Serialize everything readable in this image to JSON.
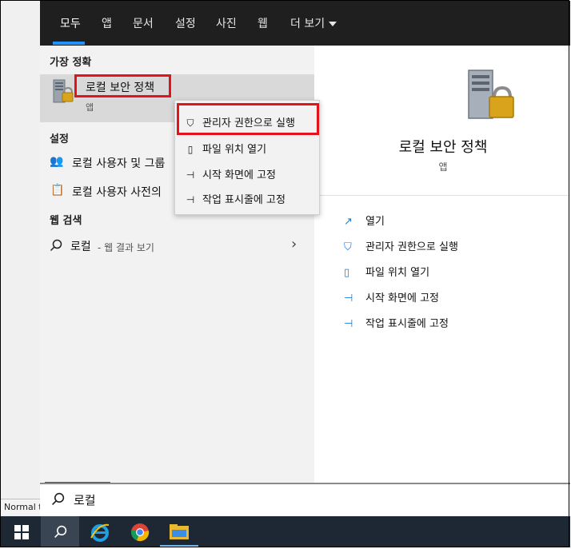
{
  "background": {
    "normal_label": "Normal t"
  },
  "tabs": [
    {
      "label": "모두",
      "active": true
    },
    {
      "label": "앱"
    },
    {
      "label": "문서"
    },
    {
      "label": "설정"
    },
    {
      "label": "사진"
    },
    {
      "label": "웹"
    },
    {
      "label": "더 보기"
    }
  ],
  "left": {
    "best_match_header": "가장 정확",
    "best_match": {
      "title": "로컬 보안 정책",
      "subtitle": "앱"
    },
    "settings_header": "설정",
    "settings_items": [
      {
        "label": "로컬 사용자 및 그룹"
      },
      {
        "label": "로컬 사용자 사전의"
      }
    ],
    "web_header": "웹 검색",
    "web_item": {
      "query": "로컬",
      "suffix": " - 웹 결과 보기"
    }
  },
  "context_menu": [
    {
      "label": "관리자 권한으로 실행",
      "icon": "shield-icon"
    },
    {
      "label": "파일 위치 열기",
      "icon": "file-location-icon"
    },
    {
      "label": "시작 화면에 고정",
      "icon": "pin-icon"
    },
    {
      "label": "작업 표시줄에 고정",
      "icon": "pin-icon"
    }
  ],
  "right": {
    "title": "로컬 보안 정책",
    "subtitle": "앱",
    "actions": [
      {
        "label": "열기",
        "icon": "open-icon"
      },
      {
        "label": "관리자 권한으로 실행",
        "icon": "shield-icon"
      },
      {
        "label": "파일 위치 열기",
        "icon": "file-location-icon"
      },
      {
        "label": "시작 화면에 고정",
        "icon": "pin-icon"
      },
      {
        "label": "작업 표시줄에 고정",
        "icon": "pin-icon"
      }
    ]
  },
  "search": {
    "value": "로컬"
  },
  "colors": {
    "accent": "#1e90ff",
    "highlight_box": "#e3121b",
    "taskbar": "#1e2835"
  }
}
